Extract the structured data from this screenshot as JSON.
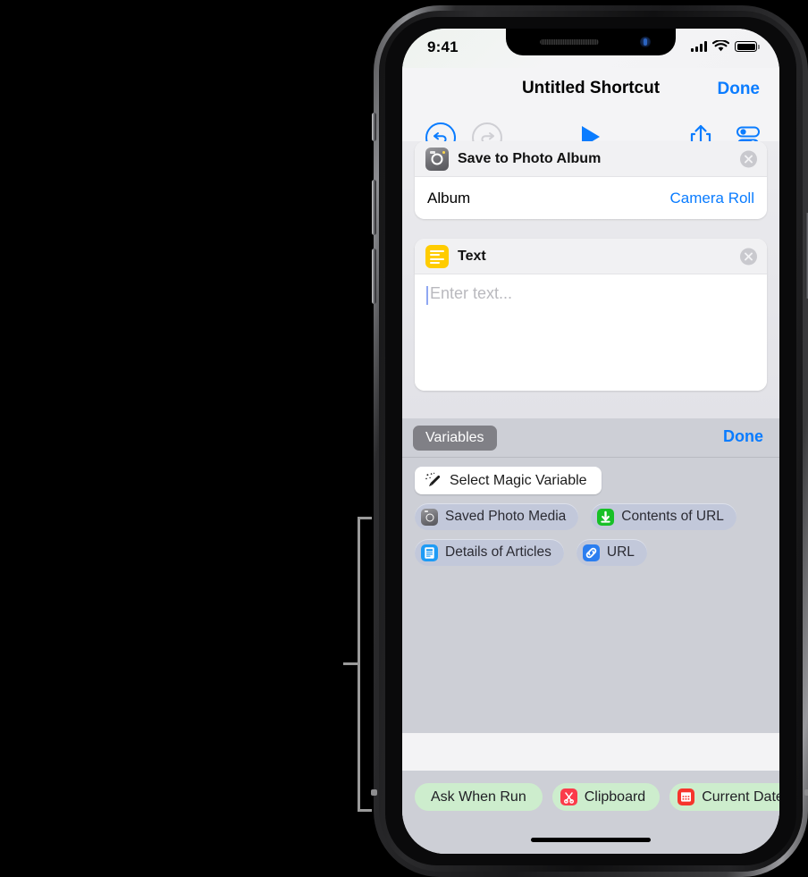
{
  "device": {
    "hardware_buttons": [
      "silent-switch",
      "volume-up",
      "volume-down",
      "power"
    ]
  },
  "status_bar": {
    "time": "9:41",
    "signal_icon": "cellular-bars-icon",
    "wifi_icon": "wifi-icon",
    "battery_icon": "battery-full-icon"
  },
  "nav_bar": {
    "title": "Untitled Shortcut",
    "done_label": "Done"
  },
  "toolbar": {
    "undo_icon": "undo-arrow-icon",
    "redo_icon": "redo-arrow-icon",
    "play_icon": "play-triangle-icon",
    "share_icon": "share-upload-icon",
    "settings_icon": "toggles-settings-icon",
    "undo_enabled_color": "#0a7cff",
    "redo_disabled_color": "#cfcfd4"
  },
  "actions": [
    {
      "title": "Save to Photo Album",
      "icon": "camera-icon",
      "remove_icon": "close-circle-icon",
      "parameters": [
        {
          "label": "Album",
          "value": "Camera Roll"
        }
      ]
    },
    {
      "title": "Text",
      "icon": "text-lines-icon",
      "remove_icon": "close-circle-icon",
      "text_field": {
        "value": "",
        "placeholder": "Enter text..."
      }
    }
  ],
  "variables_bar": {
    "chip_label": "Variables",
    "done_label": "Done"
  },
  "variables_panel": {
    "magic_button": {
      "label": "Select Magic Variable",
      "icon": "magic-wand-icon"
    },
    "tokens": [
      {
        "label": "Saved Photo Media",
        "icon": "camera-icon"
      },
      {
        "label": "Contents of URL",
        "icon": "download-arrow-icon"
      },
      {
        "label": "Details of Articles",
        "icon": "document-icon"
      },
      {
        "label": "URL",
        "icon": "link-icon"
      }
    ]
  },
  "keyboard_accessory": {
    "chips": [
      {
        "label": "Ask When Run",
        "icon": null
      },
      {
        "label": "Clipboard",
        "icon": "scissors-icon"
      },
      {
        "label": "Current Date",
        "icon": "calendar-icon"
      }
    ]
  },
  "colors": {
    "accent_blue": "#0a7cff",
    "text_icon_yellow": "#ffcc00",
    "download_green": "#17c027",
    "document_blue": "#1e9bf5",
    "link_blue": "#2b7ef0",
    "clipboard_red": "#fb3b4a",
    "calendar_red": "#f6352c",
    "token_pill": "#c2c8da",
    "keyboard_chip_green": "#cdedcd",
    "panel_gray": "#cdcfd6"
  }
}
